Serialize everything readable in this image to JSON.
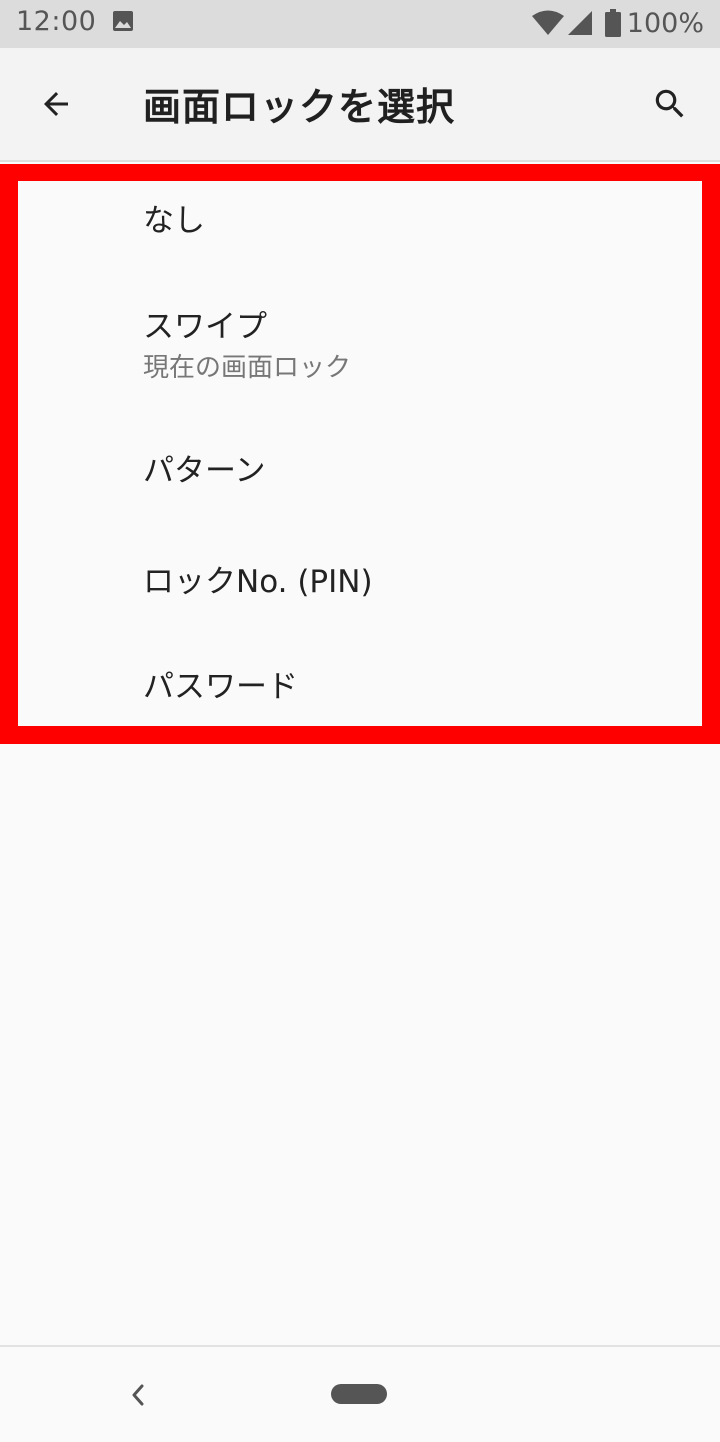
{
  "status_bar": {
    "time": "12:00",
    "battery": "100%",
    "icons": [
      "photo-icon",
      "wifi-icon",
      "signal-icon",
      "battery-icon"
    ]
  },
  "app_bar": {
    "title": "画面ロックを選択",
    "back_icon": "arrow-left-icon",
    "search_icon": "search-icon"
  },
  "options": [
    {
      "label": "なし"
    },
    {
      "label": "スワイプ",
      "sublabel": "現在の画面ロック"
    },
    {
      "label": "パターン"
    },
    {
      "label": "ロックNo. (PIN)"
    },
    {
      "label": "パスワード"
    }
  ],
  "nav_bar": {
    "back_icon": "chevron-left-icon",
    "home_icon": "home-pill-icon"
  },
  "colors": {
    "highlight": "#ff0000",
    "status_bar_bg": "#dcdcdc",
    "app_bar_bg": "#f3f3f3",
    "page_bg": "#fafafa"
  }
}
